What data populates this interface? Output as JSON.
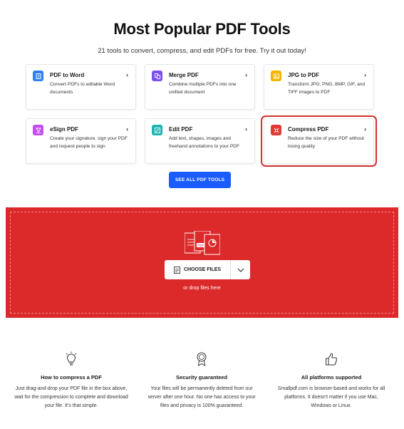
{
  "header": {
    "title": "Most Popular PDF Tools",
    "subtitle": "21 tools to convert, compress, and edit PDFs for free. Try it out today!"
  },
  "tools": [
    {
      "name": "PDF to Word",
      "desc": "Convert PDFs to editable Word documents",
      "icon": "word-icon",
      "color": "#2f7ef5"
    },
    {
      "name": "Merge PDF",
      "desc": "Combine multiple PDFs into one unified document",
      "icon": "merge-icon",
      "color": "#7b4ff2"
    },
    {
      "name": "JPG to PDF",
      "desc": "Transform JPG, PNG, BMP, GIF, and TIFF images to PDF",
      "icon": "image-icon",
      "color": "#f5b400"
    },
    {
      "name": "eSign PDF",
      "desc": "Create your signature, sign your PDF and request people to sign",
      "icon": "sign-icon",
      "color": "#c54cf0"
    },
    {
      "name": "Edit PDF",
      "desc": "Add text, shapes, images and freehand annotations to your PDF",
      "icon": "edit-icon",
      "color": "#1fb3b3"
    },
    {
      "name": "Compress PDF",
      "desc": "Reduce the size of your PDF without losing quality",
      "icon": "compress-icon",
      "color": "#e53935"
    }
  ],
  "see_all_label": "SEE ALL PDF TOOLS",
  "dropzone": {
    "choose_label": "CHOOSE FILES",
    "or_drop": "or drop files here",
    "bg_color": "#dc2a2a"
  },
  "features": [
    {
      "icon": "lightbulb-icon",
      "title": "How to compress a PDF",
      "body": "Just drag-and-drop your PDF file in the box above, wait for the compression to complete and download your file. It's that simple."
    },
    {
      "icon": "award-icon",
      "title": "Security guaranteed",
      "body": "Your files will be permanently deleted from our server after one hour. No one has access to your files and privacy is 100% guaranteed."
    },
    {
      "icon": "thumbs-up-icon",
      "title": "All platforms supported",
      "body": "Smallpdf.com is browser-based and works for all platforms. It doesn't matter if you use Mac, Windows or Linux."
    }
  ]
}
